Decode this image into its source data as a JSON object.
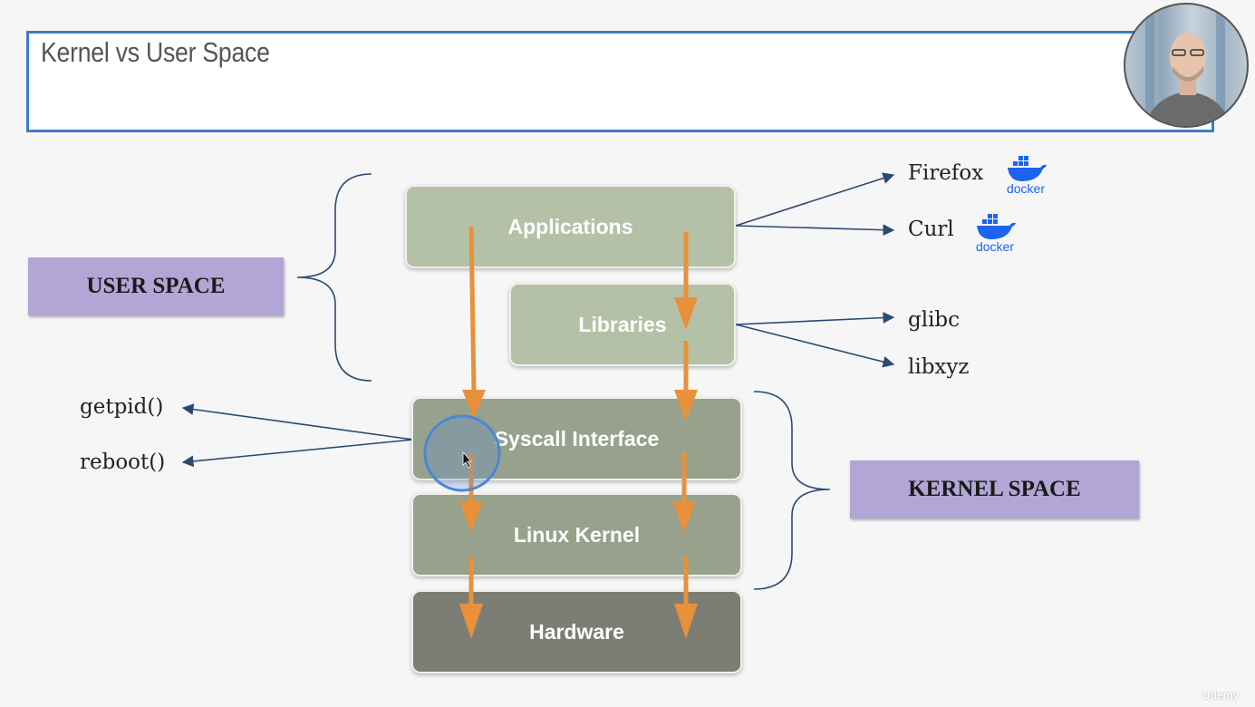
{
  "slide": {
    "title": "Kernel vs User Space"
  },
  "layers": {
    "applications": "Applications",
    "libraries": "Libraries",
    "syscall": "Syscall Interface",
    "kernel": "Linux Kernel",
    "hardware": "Hardware"
  },
  "spaces": {
    "user": "USER SPACE",
    "kernel": "KERNEL SPACE"
  },
  "apps": [
    {
      "label": "Firefox",
      "logo": "docker"
    },
    {
      "label": "Curl",
      "logo": "docker"
    }
  ],
  "libs": [
    "glibc",
    "libxyz"
  ],
  "syscalls": [
    "getpid()",
    "reboot()"
  ],
  "logo_text": "docker",
  "watermark": "Udemy",
  "colors": {
    "header_border": "#3b7fc4",
    "layer_light": "#b4c1a7",
    "layer_mid": "#97a18c",
    "layer_dark": "#7c7e76",
    "space_label": "#b2a6d6",
    "flow_arrow": "#e8903a",
    "link_arrow": "#2b4a72",
    "docker_blue": "#1d63ed"
  }
}
